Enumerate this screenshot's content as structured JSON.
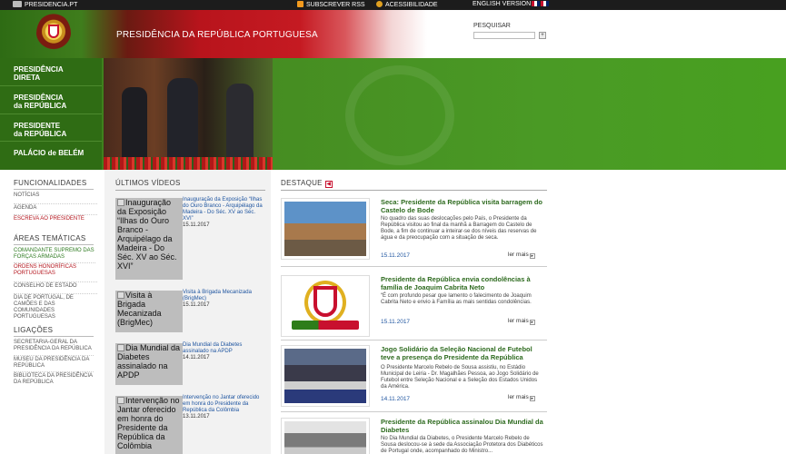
{
  "topbar": {
    "site": "PRESIDENCIA.PT",
    "rss": "SUBSCREVER RSS",
    "accessibility": "ACESSIBILIDADE",
    "english": "ENGLISH VERSION"
  },
  "header": {
    "title": "PRESIDÊNCIA DA REPÚBLICA PORTUGUESA",
    "search_label": "PESQUISAR",
    "search_button": "+"
  },
  "nav": [
    {
      "line1": "PRESIDÊNCIA",
      "line2": "DIRETA"
    },
    {
      "line1": "PRESIDÊNCIA",
      "line2": "da REPÚBLICA"
    },
    {
      "line1": "PRESIDENTE",
      "line2": "da REPÚBLICA"
    },
    {
      "line1": "PALÁCIO de BELÉM",
      "line2": ""
    }
  ],
  "left": {
    "funcionalidades_title": "FUNCIONALIDADES",
    "funcionalidades": [
      "NOTÍCIAS",
      "AGENDA",
      "ESCREVA AO PRESIDENTE"
    ],
    "areas_title": "ÁREAS TEMÁTICAS",
    "areas": [
      "COMANDANTE SUPREMO DAS FORÇAS ARMADAS",
      "ORDENS HONORÍFICAS PORTUGUESAS",
      "CONSELHO DE ESTADO",
      "DIA DE PORTUGAL, DE CAMÕES E DAS COMUNIDADES PORTUGUESAS"
    ],
    "ligacoes_title": "LIGAÇÕES",
    "ligacoes": [
      "SECRETARIA-GERAL DA PRESIDÊNCIA DA REPÚBLICA",
      "MUSEU DA PRESIDÊNCIA DA REPÚBLICA",
      "BIBLIOTECA DA PRESIDÊNCIA DA REPÚBLICA"
    ]
  },
  "videos": {
    "title": "ÚLTIMOS VÍDEOS",
    "items": [
      {
        "alt": "Inauguração da Exposição “Ilhas do Ouro Branco - Arquipélago da Madeira - Do Séc. XV ao Séc. XVI”",
        "caption": "Inauguração da Exposição “Ilhas do Ouro Branco - Arquipélago da Madeira - Do Séc. XV ao Séc. XVI”",
        "date": "15.11.2017"
      },
      {
        "alt": "Visita à Brigada Mecanizada (BrigMec)",
        "caption": "Visita à Brigada Mecanizada (BrigMec)",
        "date": "15.11.2017"
      },
      {
        "alt": "Dia Mundial da Diabetes assinalado na APDP",
        "caption": "Dia Mundial da Diabetes assinalado na APDP",
        "date": "14.11.2017"
      },
      {
        "alt": "Intervenção no Jantar oferecido em honra do Presidente da República da Colômbia",
        "caption": "Intervenção no Jantar oferecido em honra do Presidente da República da Colômbia",
        "date": "13.11.2017"
      }
    ]
  },
  "destaque": {
    "title": "DESTAQUE",
    "more": "ler mais",
    "items": [
      {
        "title": "Seca: Presidente da República visita barragem do Castelo de Bode",
        "body": "No quadro das suas deslocações pelo País, o Presidente da República visitou ao final da manhã a Barragem do Castelo de Bode, a fim de continuar a inteirar-se dos níveis das reservas de água e da preocupação com a situação de seca.",
        "date": "15.11.2017"
      },
      {
        "title": "Presidente da República envia condolências à família de Joaquim Cabrita Neto",
        "body": "“É com profundo pesar que lamento o falecimento de Joaquim Cabrita Neto e envio à Família as mais sentidas condolências.",
        "date": "15.11.2017"
      },
      {
        "title": "Jogo Solidário da Seleção Nacional de Futebol teve a presença do Presidente da República",
        "body": "O Presidente Marcelo Rebelo de Sousa assistiu, no Estádio Municipal de Leiria - Dr. Magalhães Pessoa, ao Jogo Solidário de Futebol entre Seleção Nacional e a Seleção dos Estados Unidos da América.",
        "date": "14.11.2017"
      },
      {
        "title": "Presidente da República assinalou Dia Mundial da Diabetes",
        "body": "No Dia Mundial da Diabetes, o Presidente Marcelo Rebelo de Sousa deslocou-se à sede da Associação Protetora dos Diabéticos de Portugal onde, acompanhado do Ministro...",
        "date": ""
      }
    ]
  }
}
